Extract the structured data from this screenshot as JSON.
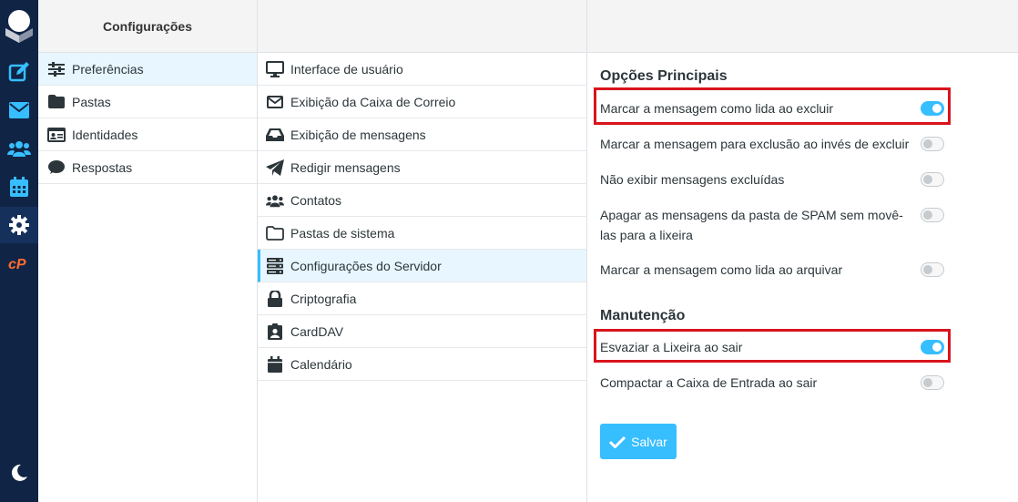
{
  "colors": {
    "nav_bg": "#102445",
    "accent": "#37beff",
    "highlight_border": "#d9141c"
  },
  "nav": {
    "items": [
      {
        "name": "compose-icon"
      },
      {
        "name": "mail-icon"
      },
      {
        "name": "contacts-icon"
      },
      {
        "name": "calendar-icon"
      },
      {
        "name": "settings-icon",
        "active": true
      },
      {
        "name": "cpanel-icon"
      },
      {
        "name": "dark-mode-icon"
      }
    ]
  },
  "col1": {
    "header": "Configurações",
    "items": [
      {
        "label": "Preferências",
        "icon": "sliders-icon",
        "selected": true
      },
      {
        "label": "Pastas",
        "icon": "folder-icon"
      },
      {
        "label": "Identidades",
        "icon": "id-card-icon"
      },
      {
        "label": "Respostas",
        "icon": "comment-icon"
      }
    ]
  },
  "col2": {
    "items": [
      {
        "label": "Interface de usuário",
        "icon": "monitor-icon"
      },
      {
        "label": "Exibição da Caixa de Correio",
        "icon": "envelope-icon"
      },
      {
        "label": "Exibição de mensagens",
        "icon": "inbox-icon"
      },
      {
        "label": "Redigir mensagens",
        "icon": "paper-plane-icon"
      },
      {
        "label": "Contatos",
        "icon": "users-icon"
      },
      {
        "label": "Pastas de sistema",
        "icon": "folder-open-icon"
      },
      {
        "label": "Configurações do Servidor",
        "icon": "server-icon",
        "selected": true
      },
      {
        "label": "Criptografia",
        "icon": "lock-icon"
      },
      {
        "label": "CardDAV",
        "icon": "address-card-icon"
      },
      {
        "label": "Calendário",
        "icon": "calendar-icon"
      }
    ]
  },
  "main": {
    "section1_title": "Opções Principais",
    "section1_options": [
      {
        "label": "Marcar a mensagem como lida ao excluir",
        "on": true
      },
      {
        "label": "Marcar a mensagem para exclusão ao invés de excluir",
        "on": false
      },
      {
        "label": "Não exibir mensagens excluídas",
        "on": false
      },
      {
        "label": "Apagar as mensagens da pasta de SPAM sem movê-las para a lixeira",
        "on": false
      },
      {
        "label": "Marcar a mensagem como lida ao arquivar",
        "on": false
      }
    ],
    "section2_title": "Manutenção",
    "section2_options": [
      {
        "label": "Esvaziar a Lixeira ao sair",
        "on": true
      },
      {
        "label": "Compactar a Caixa de Entrada ao sair",
        "on": false
      }
    ],
    "save_label": "Salvar"
  }
}
